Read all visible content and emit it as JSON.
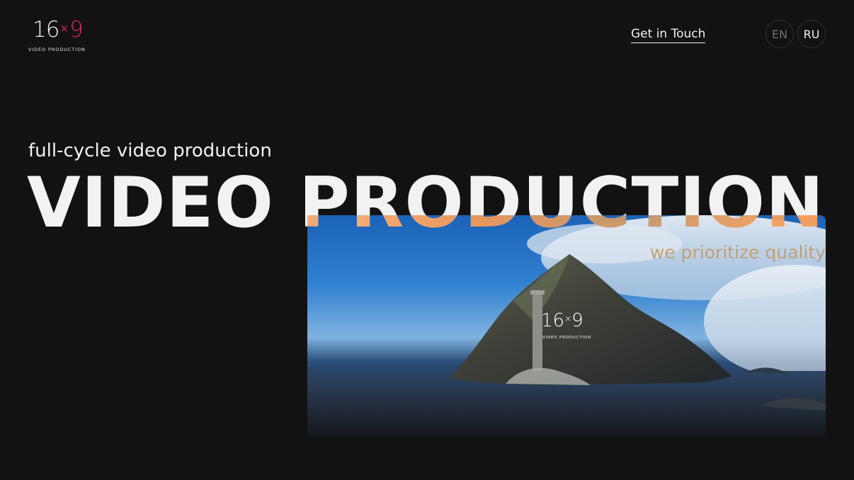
{
  "header": {
    "logo": {
      "number_left": "16",
      "times": "×",
      "number_right": "9",
      "subtitle": "VIDEO PRODUCTION"
    },
    "contact_label": "Get in Touch",
    "languages": [
      {
        "code": "EN",
        "active": false
      },
      {
        "code": "RU",
        "active": true
      }
    ]
  },
  "hero": {
    "tagline": "full-cycle video production",
    "headline": "VIDEO PRODUCTION"
  },
  "video": {
    "overlay_text": "we prioritize quality",
    "logo": {
      "number_left": "16",
      "times": "×",
      "number_right": "9",
      "subtitle": "VIDEO PRODUCTION"
    }
  },
  "colors": {
    "background": "#121212",
    "text": "#f2f2f2",
    "brand_accent": "#e0245e",
    "highlight_orange": "#ffa05a",
    "muted": "#6e6e6e"
  }
}
